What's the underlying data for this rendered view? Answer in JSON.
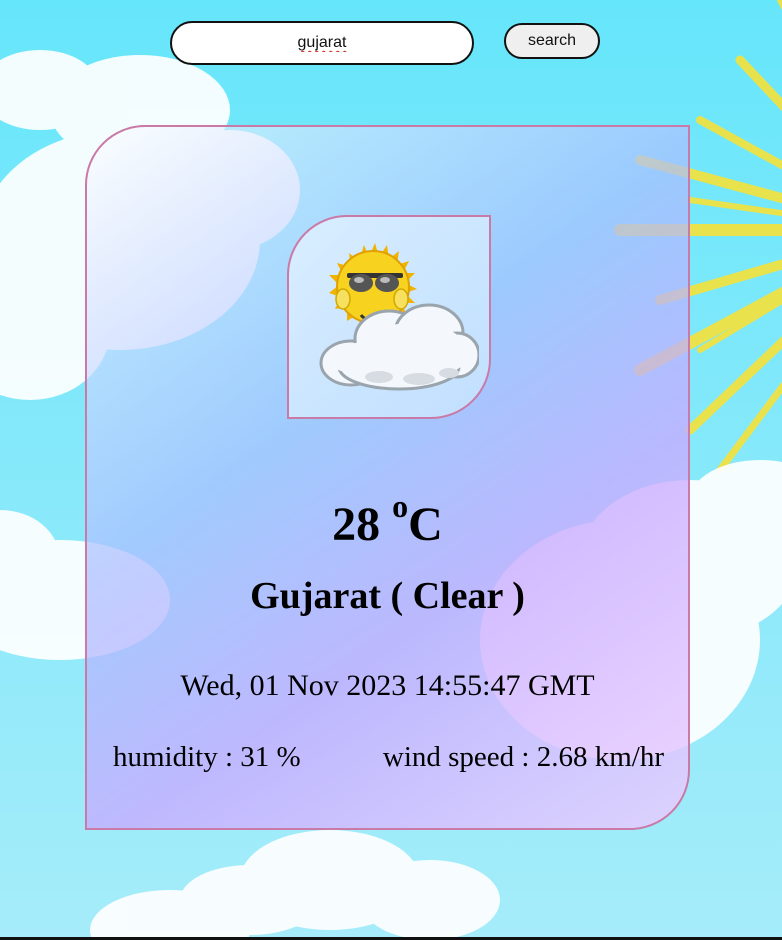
{
  "search": {
    "value": "gujarat",
    "button_label": "search"
  },
  "weather": {
    "icon": "sun-with-sunglasses-behind-cloud-icon",
    "temperature": "28",
    "unit_superscript": "o",
    "unit_letter": "C",
    "location": "Gujarat ( Clear )",
    "datetime": "Wed, 01 Nov 2023 14:55:47 GMT",
    "humidity": "humidity : 31 %",
    "wind_speed": "wind speed : 2.68 km/hr"
  },
  "colors": {
    "sky": "#6fe3f8",
    "card_border": "#c97aa6",
    "sun_rays": "#f5e23a"
  }
}
